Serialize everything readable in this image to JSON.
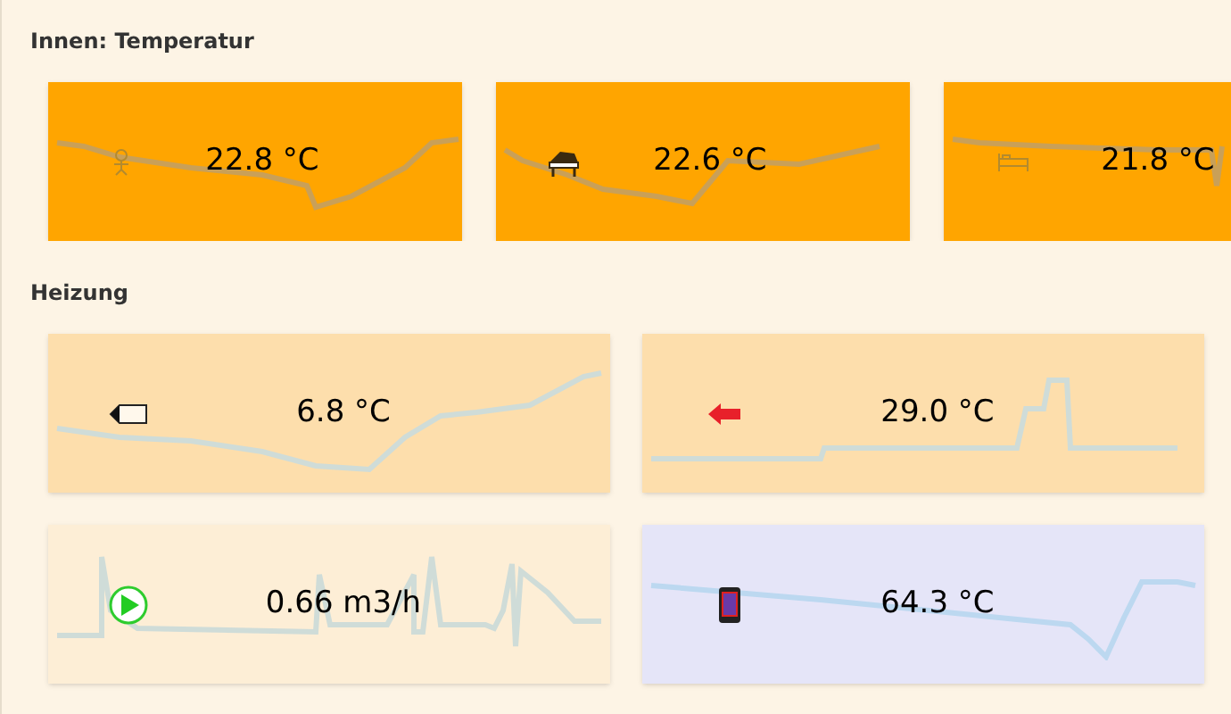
{
  "sections": [
    {
      "title": "Innen: Temperatur",
      "cards": [
        {
          "kind": "child",
          "value": "22.8 °C",
          "color": "#ffa500"
        },
        {
          "kind": "piano",
          "value": "22.6 °C",
          "color": "#ffa500"
        },
        {
          "kind": "bed",
          "value": "21.8 °C",
          "color": "#ffa500"
        }
      ]
    },
    {
      "title": "Heizung",
      "cards": [
        {
          "kind": "tag",
          "value": "6.8 °C",
          "color": "#fddeac"
        },
        {
          "kind": "arrow",
          "value": "29.0 °C",
          "color": "#fddeac"
        },
        {
          "kind": "pump",
          "value": "0.66 m3/h",
          "color": "#fdeed6"
        },
        {
          "kind": "tank",
          "value": "64.3 °C",
          "color": "#e5e5f8"
        }
      ]
    }
  ]
}
